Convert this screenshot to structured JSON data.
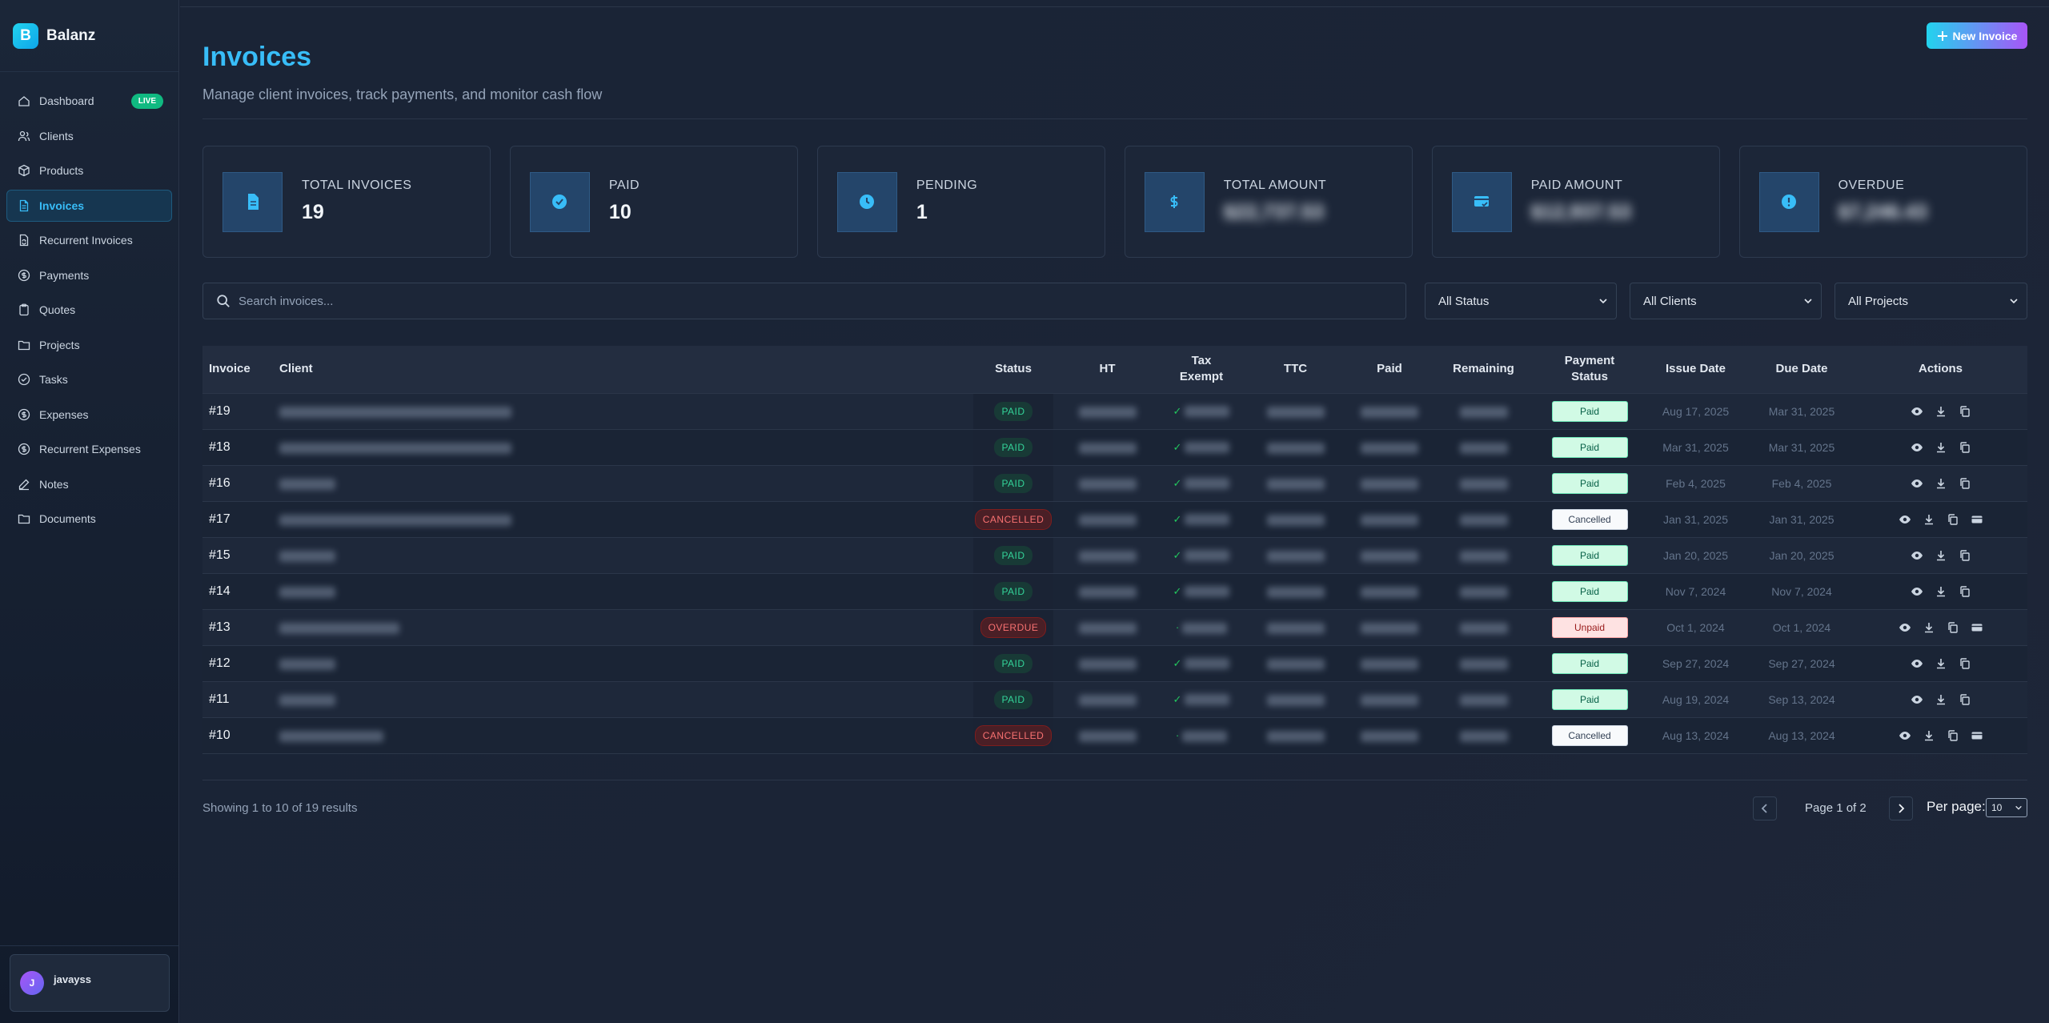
{
  "brand": {
    "logo_letter": "B",
    "name": "Balanz"
  },
  "sidebar": {
    "items": [
      {
        "label": "Dashboard",
        "icon": "home-icon",
        "badge": "LIVE"
      },
      {
        "label": "Clients",
        "icon": "users-icon"
      },
      {
        "label": "Products",
        "icon": "box-icon"
      },
      {
        "label": "Invoices",
        "icon": "file-text-icon",
        "active": true
      },
      {
        "label": "Recurrent Invoices",
        "icon": "repeat-file-icon"
      },
      {
        "label": "Payments",
        "icon": "dollar-circle-icon"
      },
      {
        "label": "Quotes",
        "icon": "clipboard-icon"
      },
      {
        "label": "Projects",
        "icon": "folder-icon"
      },
      {
        "label": "Tasks",
        "icon": "check-circle-icon"
      },
      {
        "label": "Expenses",
        "icon": "dollar-circle-icon"
      },
      {
        "label": "Recurrent Expenses",
        "icon": "dollar-circle-icon"
      },
      {
        "label": "Notes",
        "icon": "edit-icon"
      },
      {
        "label": "Documents",
        "icon": "folder-icon"
      }
    ],
    "user": {
      "initial": "J",
      "name": "javayss"
    }
  },
  "header": {
    "title": "Invoices",
    "subtitle": "Manage client invoices, track payments, and monitor cash flow",
    "new_button": "New Invoice"
  },
  "stats": [
    {
      "label": "Total Invoices",
      "value": "19",
      "icon": "document-icon"
    },
    {
      "label": "Paid",
      "value": "10",
      "icon": "check-badge-icon"
    },
    {
      "label": "Pending",
      "value": "1",
      "icon": "clock-icon"
    },
    {
      "label": "Total Amount",
      "value": "$22,737.53",
      "icon": "dollar-icon",
      "blurred": true
    },
    {
      "label": "Paid Amount",
      "value": "$12,937.53",
      "icon": "card-check-icon",
      "blurred": true
    },
    {
      "label": "Overdue",
      "value": "$7,246.43",
      "icon": "alert-circle-icon",
      "blurred": true
    }
  ],
  "filters": {
    "search_placeholder": "Search invoices...",
    "status": "All Status",
    "clients": "All Clients",
    "projects": "All Projects"
  },
  "table": {
    "columns": [
      "Invoice",
      "Client",
      "Status",
      "HT",
      "Tax Exempt",
      "TTC",
      "Paid",
      "Remaining",
      "Payment Status",
      "Issue Date",
      "Due Date",
      "Actions"
    ],
    "rows": [
      {
        "invoice": "#19",
        "status": "PAID",
        "payment_status": "Paid",
        "issue": "Aug 17, 2025",
        "due": "Mar 31, 2025",
        "client_w": 290
      },
      {
        "invoice": "#18",
        "status": "PAID",
        "payment_status": "Paid",
        "issue": "Mar 31, 2025",
        "due": "Mar 31, 2025",
        "client_w": 290
      },
      {
        "invoice": "#16",
        "status": "PAID",
        "payment_status": "Paid",
        "issue": "Feb 4, 2025",
        "due": "Feb 4, 2025",
        "client_w": 70
      },
      {
        "invoice": "#17",
        "status": "CANCELLED",
        "payment_status": "Cancelled",
        "issue": "Jan 31, 2025",
        "due": "Jan 31, 2025",
        "client_w": 290
      },
      {
        "invoice": "#15",
        "status": "PAID",
        "payment_status": "Paid",
        "issue": "Jan 20, 2025",
        "due": "Jan 20, 2025",
        "client_w": 70
      },
      {
        "invoice": "#14",
        "status": "PAID",
        "payment_status": "Paid",
        "issue": "Nov 7, 2024",
        "due": "Nov 7, 2024",
        "client_w": 70
      },
      {
        "invoice": "#13",
        "status": "OVERDUE",
        "payment_status": "Unpaid",
        "issue": "Oct 1, 2024",
        "due": "Oct 1, 2024",
        "client_w": 150
      },
      {
        "invoice": "#12",
        "status": "PAID",
        "payment_status": "Paid",
        "issue": "Sep 27, 2024",
        "due": "Sep 27, 2024",
        "client_w": 70
      },
      {
        "invoice": "#11",
        "status": "PAID",
        "payment_status": "Paid",
        "issue": "Aug 19, 2024",
        "due": "Sep 13, 2024",
        "client_w": 70
      },
      {
        "invoice": "#10",
        "status": "CANCELLED",
        "payment_status": "Cancelled",
        "issue": "Aug 13, 2024",
        "due": "Aug 13, 2024",
        "client_w": 130
      }
    ]
  },
  "pagination": {
    "showing": "Showing 1 to 10 of 19 results",
    "page_text": "Page 1 of 2",
    "per_page_label": "Per page:",
    "per_page_value": "10"
  },
  "colors": {
    "accent": "#38bdf8",
    "paid": "#34d399",
    "cancelled": "#f87171",
    "live": "#10b981"
  }
}
